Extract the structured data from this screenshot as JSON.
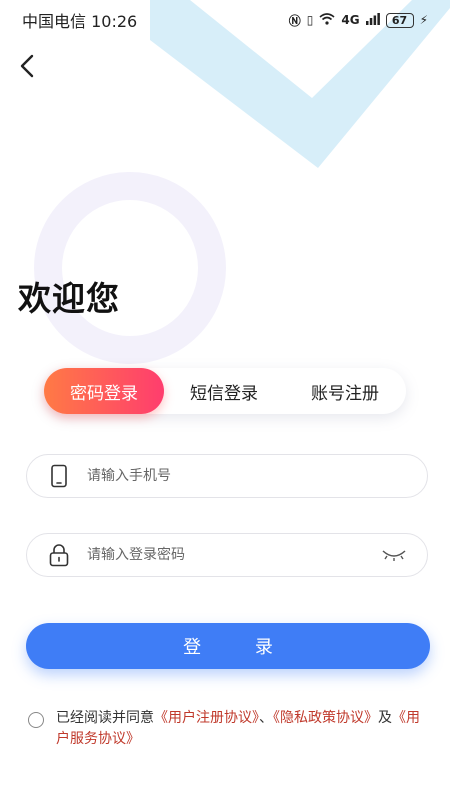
{
  "status_bar": {
    "carrier": "中国电信",
    "time": "10:26",
    "network": "4G",
    "battery": "67"
  },
  "page": {
    "welcome": "欢迎您"
  },
  "tabs": [
    {
      "label": "密码登录",
      "active": true
    },
    {
      "label": "短信登录",
      "active": false
    },
    {
      "label": "账号注册",
      "active": false
    }
  ],
  "form": {
    "phone": {
      "placeholder": "请输入手机号",
      "value": "",
      "icon": "phone-icon"
    },
    "password": {
      "placeholder": "请输入登录密码",
      "value": "",
      "icon": "lock-icon",
      "toggle_icon": "eye-closed-icon"
    },
    "login_label": "登 录"
  },
  "agreement": {
    "prefix": "已经阅读并同意",
    "user_agreement": "《用户注册协议》",
    "separator": "、",
    "privacy_policy": "《隐私政策协议》",
    "and": "及",
    "service_agreement": "《用户服务协议》",
    "checked": false
  },
  "colors": {
    "accent_gradient_start": "#ff7a45",
    "accent_gradient_end": "#ff3d6e",
    "primary_button": "#3f7df6",
    "link": "#c0392b",
    "deco_stripe": "#cde9f8",
    "deco_ring": "#f1effb"
  }
}
